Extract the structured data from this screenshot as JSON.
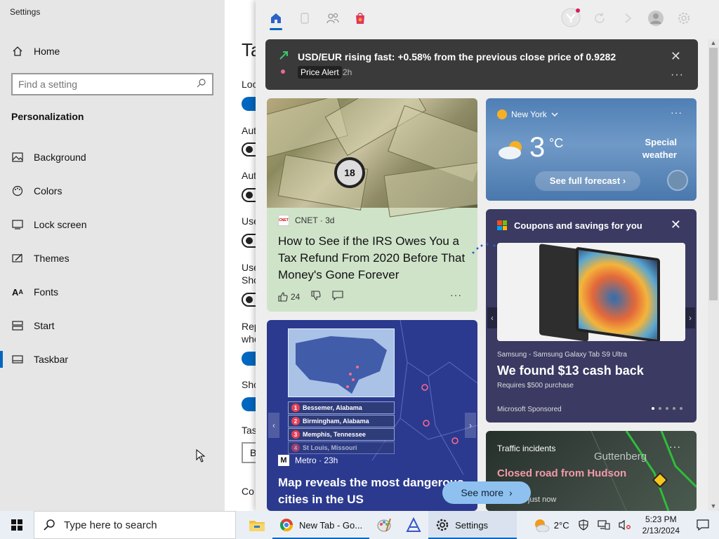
{
  "settings": {
    "app_title": "Settings",
    "home_label": "Home",
    "search_placeholder": "Find a setting",
    "section_title": "Personalization",
    "nav_items": [
      {
        "label": "Background",
        "icon": "image-icon"
      },
      {
        "label": "Colors",
        "icon": "palette-icon"
      },
      {
        "label": "Lock screen",
        "icon": "lock-screen-icon"
      },
      {
        "label": "Themes",
        "icon": "themes-icon"
      },
      {
        "label": "Fonts",
        "icon": "fonts-icon"
      },
      {
        "label": "Start",
        "icon": "start-icon"
      },
      {
        "label": "Taskbar",
        "icon": "taskbar-icon",
        "active": true
      }
    ],
    "page_heading": "Ta",
    "options": [
      {
        "label": "Loc",
        "state": "on"
      },
      {
        "label": "Aut",
        "state": "off"
      },
      {
        "label": "Aut",
        "state": "off"
      },
      {
        "label": "Use",
        "state": "off"
      },
      {
        "label": "Use",
        "label2": "Sho",
        "state": "off"
      },
      {
        "label": "Rep",
        "label2": "whe",
        "state": "on"
      },
      {
        "label": "Sho",
        "state": "on"
      }
    ],
    "select_label": "Tas",
    "select_value": "B",
    "bottom_label": "Co"
  },
  "news": {
    "header_icons": [
      "home-icon",
      "gaming-icon",
      "people-icon",
      "shopping-icon",
      "profile-badge-icon",
      "refresh-icon",
      "forward-icon",
      "avatar-icon",
      "settings-icon"
    ],
    "alert": {
      "title": "USD/EUR rising fast: +0.58% from the previous close price of 0.9282",
      "badge": "Price Alert",
      "time": "2h"
    },
    "cnet": {
      "source": "CNET · 3d",
      "logo_text": "CNET",
      "headline": "How to See if the IRS Owes You a Tax Refund From 2020 Before That Money's Gone Forever",
      "likes": "24",
      "coin": "18"
    },
    "weather": {
      "location": "New York",
      "temp": "3",
      "unit": "°C",
      "special": "Special weather",
      "forecast_label": "See full forecast"
    },
    "coupons": {
      "title": "Coupons and savings for you",
      "brand": "Samsung - Samsung Galaxy Tab S9 Ultra",
      "headline": "We found $13 cash back",
      "sub": "Requires $500 purchase",
      "sponsor": "Microsoft Sponsored"
    },
    "map": {
      "list": [
        {
          "n": "1",
          "city": "Bessemer, Alabama"
        },
        {
          "n": "2",
          "city": "Birmingham, Alabama"
        },
        {
          "n": "3",
          "city": "Memphis, Tennessee"
        },
        {
          "n": "4",
          "city": "St Louis, Missouri"
        }
      ],
      "logo_text": "M",
      "source": "Metro · 23h",
      "headline": "Map reveals the most dangerous cities in the US"
    },
    "traffic": {
      "title": "Traffic incidents",
      "town": "Guttenberg",
      "headline": "Closed road from Hudson Pkw...",
      "time": "just now"
    },
    "see_more": "See more"
  },
  "taskbar": {
    "search_placeholder": "Type here to search",
    "apps": [
      {
        "name": "file-explorer-icon",
        "label": ""
      },
      {
        "name": "chrome-icon",
        "label": "New Tab - Go..."
      },
      {
        "name": "paint-icon",
        "label": ""
      },
      {
        "name": "vector-app-icon",
        "label": ""
      },
      {
        "name": "settings-gear-icon",
        "label": "Settings"
      }
    ],
    "weather_temp": "2°C",
    "time": "5:23 PM",
    "date": "2/13/2024"
  },
  "colors": {
    "accent": "#0067c0",
    "nav_bg": "#e6e6e6",
    "alert_bg": "#3a3a3a",
    "cnet_bg": "#cfe3c9",
    "coupons_bg": "#3a3a63",
    "map_bg": "#2b3a8f"
  }
}
